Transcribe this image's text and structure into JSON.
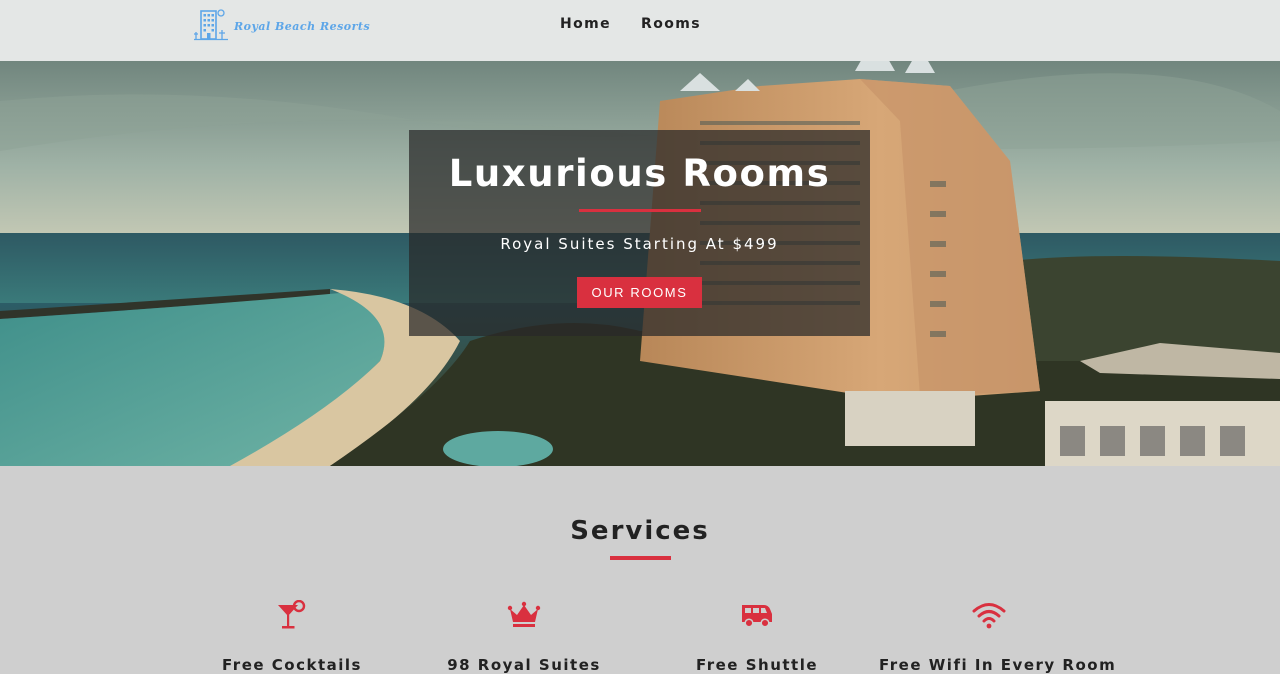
{
  "brand": {
    "name": "Royal Beach Resorts",
    "icon": "hotel-building-icon",
    "color": "#5da6e8"
  },
  "nav": {
    "items": [
      {
        "label": "Home"
      },
      {
        "label": "Rooms"
      }
    ]
  },
  "hero": {
    "title": "Luxurious Rooms",
    "subtitle": "Royal Suites Starting At $499",
    "button_label": "OUR ROOMS",
    "accent_color": "#d9303f"
  },
  "services": {
    "title": "Services",
    "items": [
      {
        "icon": "cocktail-icon",
        "label": "Free Cocktails"
      },
      {
        "icon": "crown-icon",
        "label": "98 Royal Suites"
      },
      {
        "icon": "shuttle-van-icon",
        "label": "Free Shuttle"
      },
      {
        "icon": "wifi-icon",
        "label": "Free Wifi In Every Room"
      }
    ]
  }
}
